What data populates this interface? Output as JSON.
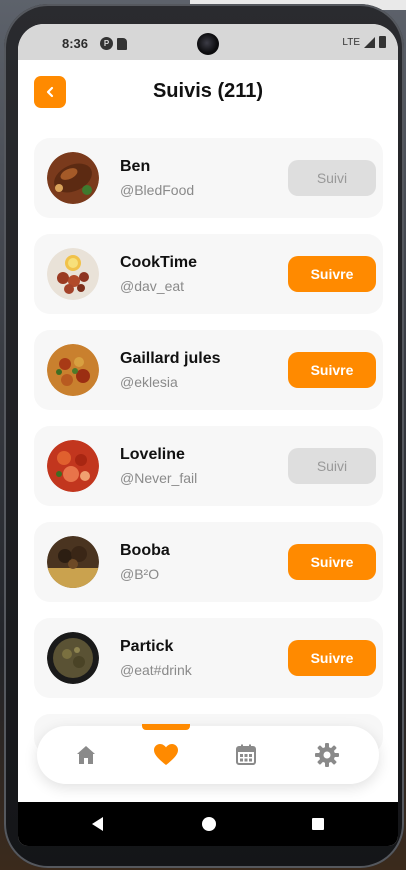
{
  "status_bar": {
    "time": "8:36",
    "network": "LTE",
    "icons": [
      "notification-icon",
      "sd-card-icon",
      "signal-icon",
      "battery-icon"
    ]
  },
  "header": {
    "title": "Suivis (211)",
    "back_icon": "chevron-left-icon"
  },
  "colors": {
    "accent": "#ff8a00",
    "card_bg": "#f7f7f7",
    "following_bg": "#dedede",
    "muted_text": "#8a8a8a"
  },
  "follows": [
    {
      "name": "Ben",
      "handle": "@BledFood",
      "button": "Suivi"
    },
    {
      "name": "CookTime",
      "handle": "@dav_eat",
      "button": "Suivre"
    },
    {
      "name": "Gaillard jules",
      "handle": "@eklesia",
      "button": "Suivre"
    },
    {
      "name": "Loveline",
      "handle": "@Never_fail",
      "button": "Suivi"
    },
    {
      "name": "Booba",
      "handle": "@B²O",
      "button": "Suivre"
    },
    {
      "name": "Partick",
      "handle": "@eat#drink",
      "button": "Suivre"
    }
  ],
  "bottom_nav": {
    "items": [
      "home-icon",
      "heart-icon",
      "calendar-icon",
      "settings-icon"
    ],
    "active": "heart-icon"
  },
  "system_nav": [
    "back-icon",
    "home-circle-icon",
    "recents-icon"
  ]
}
